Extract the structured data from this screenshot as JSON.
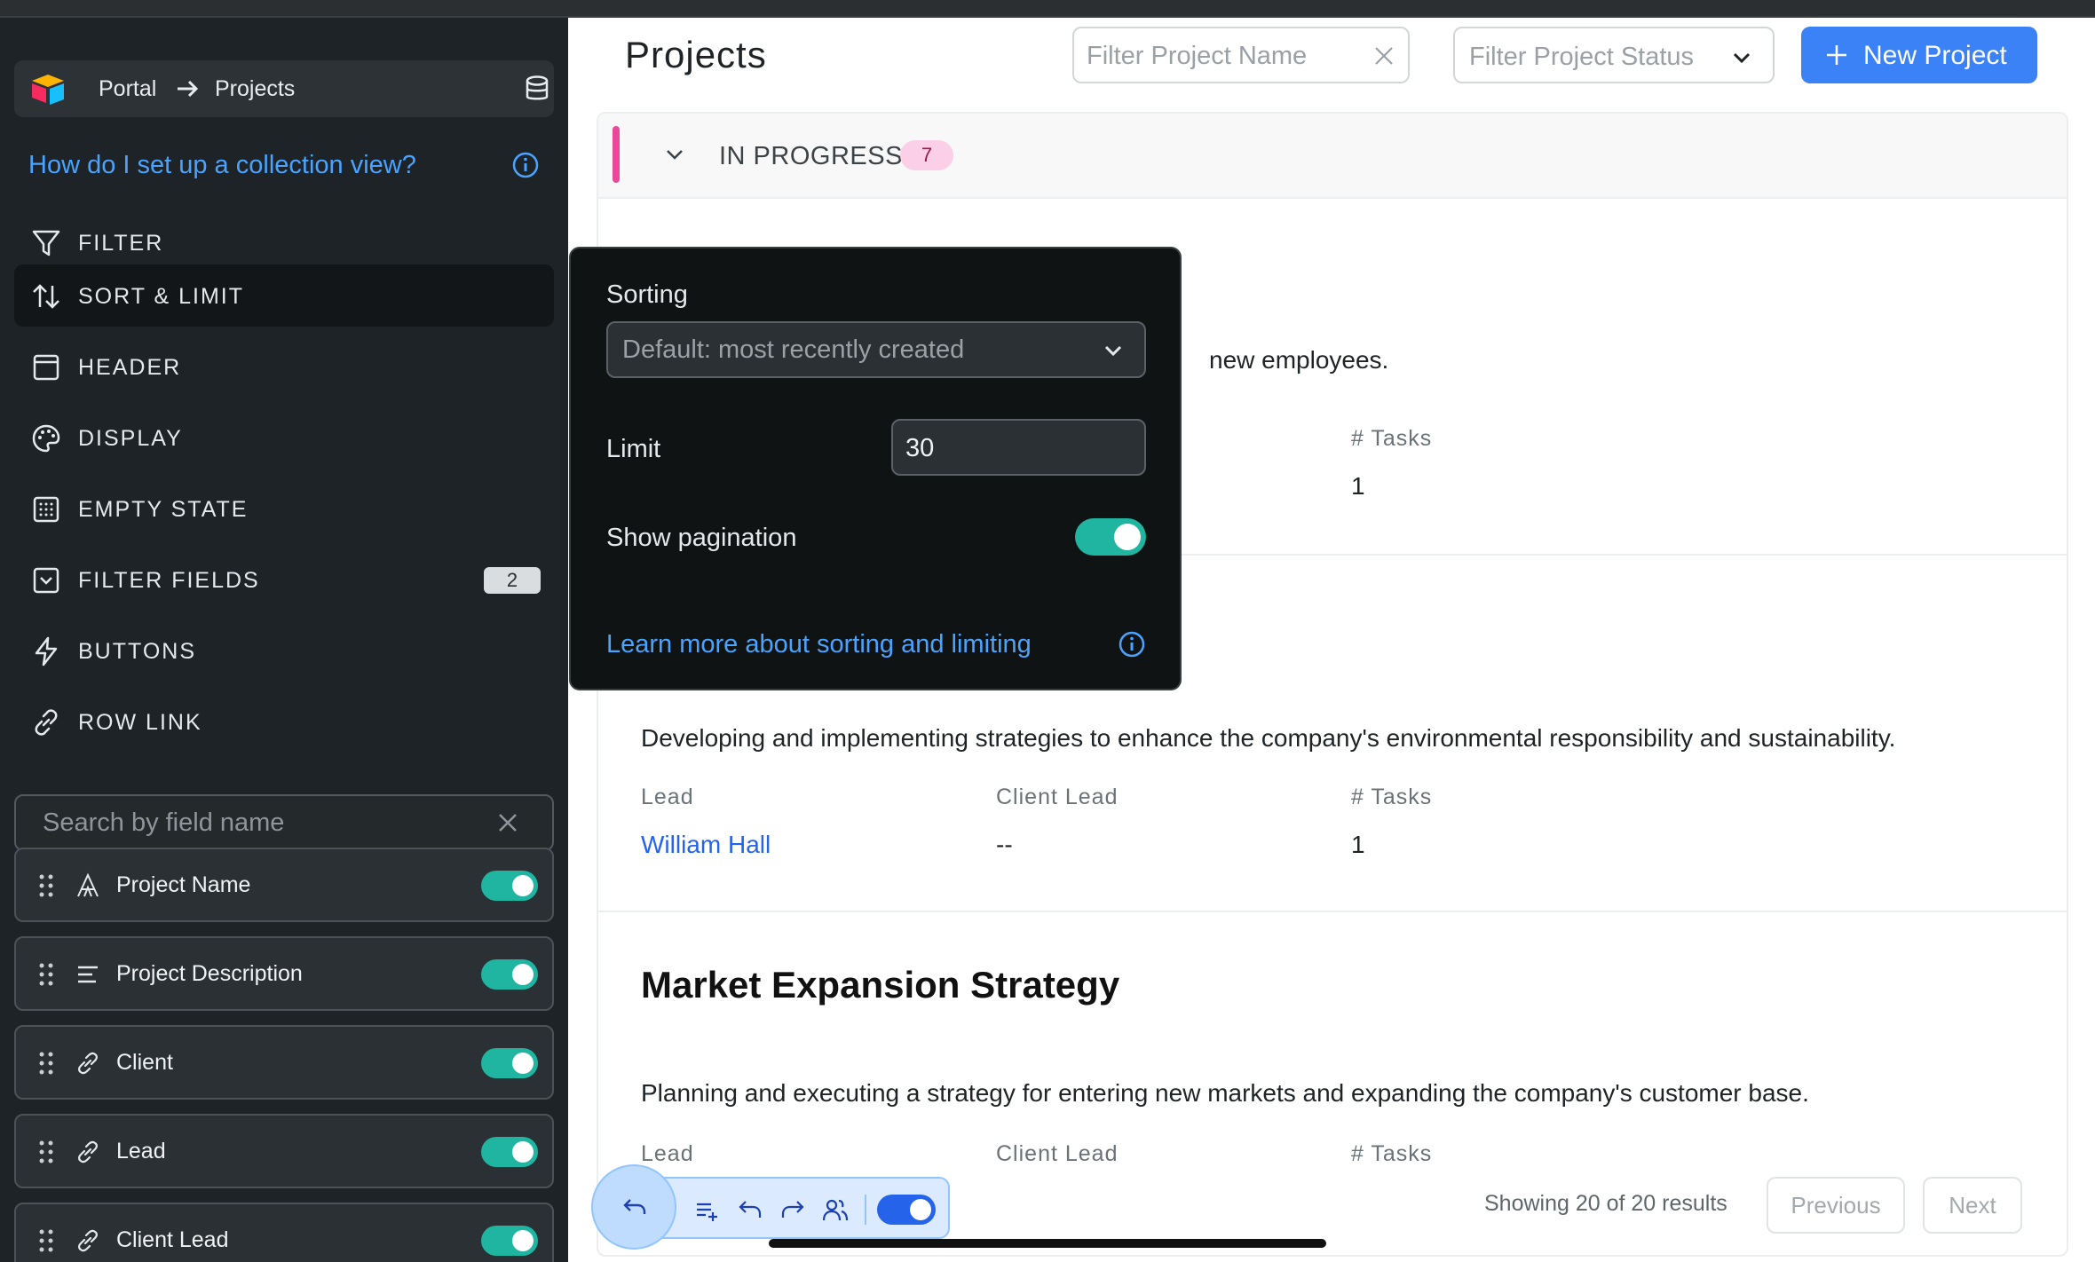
{
  "breadcrumb": {
    "root": "Portal",
    "current": "Projects"
  },
  "help_link": "How do I set up a collection view?",
  "nav": {
    "filter": "FILTER",
    "sort_limit": "SORT & LIMIT",
    "header": "HEADER",
    "display": "DISPLAY",
    "empty_state": "EMPTY STATE",
    "filter_fields": "FILTER FIELDS",
    "filter_fields_count": "2",
    "buttons": "BUTTONS",
    "row_link": "ROW LINK"
  },
  "field_search": {
    "placeholder": "Search by field name"
  },
  "fields": [
    {
      "label": "Project Name",
      "icon": "text-icon",
      "enabled": true
    },
    {
      "label": "Project Description",
      "icon": "paragraph-icon",
      "enabled": true
    },
    {
      "label": "Client",
      "icon": "link-icon",
      "enabled": true
    },
    {
      "label": "Lead",
      "icon": "link-icon",
      "enabled": true
    },
    {
      "label": "Client Lead",
      "icon": "link-icon",
      "enabled": true
    }
  ],
  "page": {
    "title": "Projects",
    "filter_name_placeholder": "Filter Project Name",
    "filter_status_placeholder": "Filter Project Status",
    "new_button": "New Project"
  },
  "group": {
    "name": "IN PROGRESS",
    "count": "7",
    "color": "#ec4899"
  },
  "cards": [
    {
      "description_tail": "new employees.",
      "tasks_label": "# Tasks",
      "tasks": "1"
    },
    {
      "description": "Developing and implementing strategies to enhance the company's environmental responsibility and sustainability.",
      "lead_label": "Lead",
      "lead": "William Hall",
      "client_lead_label": "Client Lead",
      "client_lead": "--",
      "tasks_label": "# Tasks",
      "tasks": "1"
    },
    {
      "title": "Market Expansion Strategy",
      "description": "Planning and executing a strategy for entering new markets and expanding the company's customer base.",
      "lead_label": "Lead",
      "client_lead_label": "Client Lead",
      "tasks_label": "# Tasks"
    }
  ],
  "popover": {
    "sorting_label": "Sorting",
    "sorting_value": "Default: most recently created",
    "limit_label": "Limit",
    "limit_value": "30",
    "pagination_label": "Show pagination",
    "pagination_enabled": true,
    "learn_more": "Learn more about sorting and limiting"
  },
  "pagination": {
    "showing": "Showing 20 of 20 results",
    "previous": "Previous",
    "next": "Next"
  },
  "colors": {
    "accent": "#3b82f6",
    "toggle": "#1fb5a0",
    "link": "#4aa3ff"
  }
}
